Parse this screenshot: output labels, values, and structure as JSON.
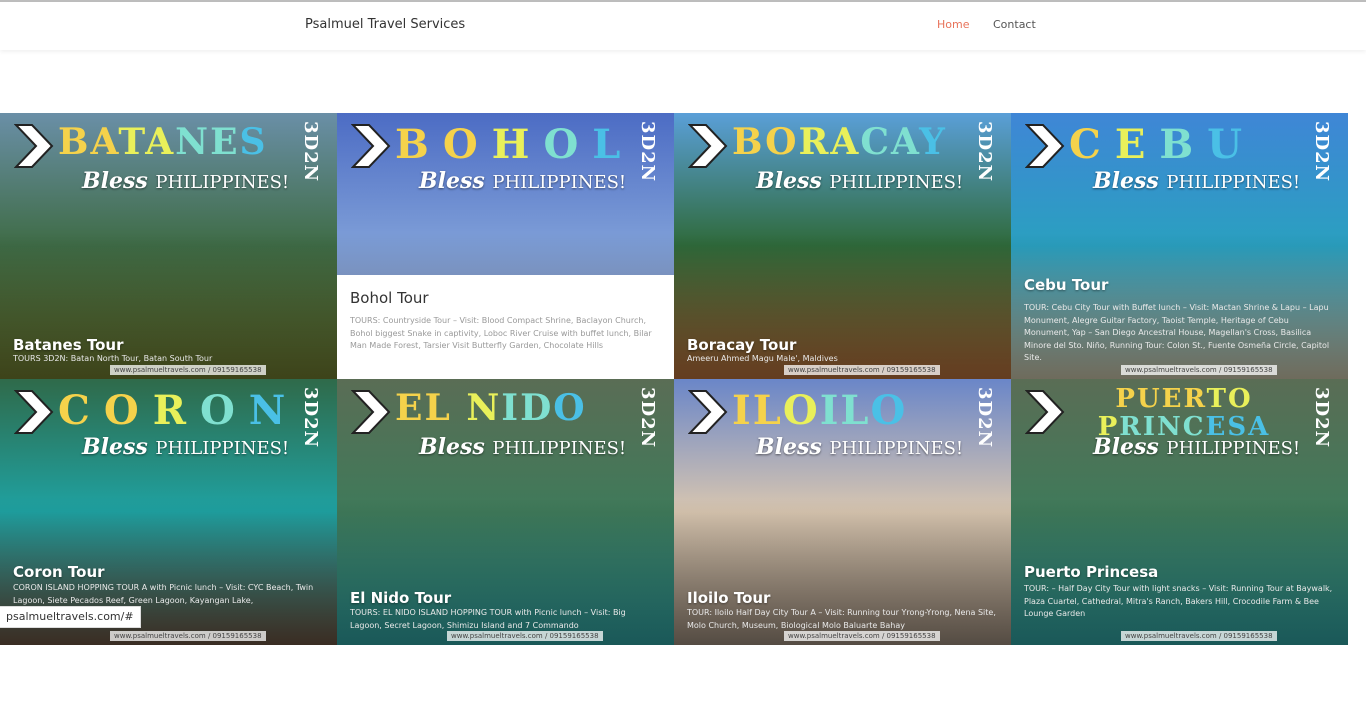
{
  "nav": {
    "brand": "Psalmuel Travel Services",
    "links": [
      "Home",
      "Contact"
    ]
  },
  "status_url": "psalmueltravels.com/#",
  "overlay": {
    "bless": "Bless",
    "philippines": "PHILIPPINES!",
    "days": "3D2N",
    "watermark": "www.psalmueltravels.com / 09159165538"
  },
  "tours": [
    {
      "dest": "BATANES",
      "title": "Batanes Tour",
      "desc": "TOURS 3D2N: Batan North Tour, Batan South Tour",
      "colors": [
        "#f5d24b",
        "#e9f05a",
        "#7fe0d0",
        "#4ac0e6"
      ],
      "bg": [
        "#6a8fa7",
        "#3f6c46",
        "#6f7a2f"
      ]
    },
    {
      "dest": "BOHOL",
      "title": "Bohol Tour",
      "desc": "TOURS: Countryside Tour – Visit: Blood Compact Shrine, Baclayon Church, Bohol biggest Snake in captivity, Loboc River Cruise with buffet lunch, Bilar Man Made Forest, Tarsier Visit Butterfly Garden, Chocolate Hills",
      "colors": [
        "#f5d24b",
        "#e9f05a",
        "#7fe0d0",
        "#4ac0e6"
      ],
      "bg": [
        "#4c6cc4",
        "#7f9fd8",
        "#b8c7e6"
      ]
    },
    {
      "dest": "BORACAY",
      "title": "Boracay Tour",
      "desc": "Ameeru Ahmed Magu Male', Maldives",
      "colors": [
        "#f5d24b",
        "#e9f05a",
        "#7fe0d0",
        "#4ac0e6"
      ],
      "bg": [
        "#5a9fd8",
        "#2f6a3a",
        "#b66e3a"
      ]
    },
    {
      "dest": "CEBU",
      "title": "Cebu Tour",
      "desc": "TOUR: Cebu City Tour with Buffet lunch – Visit: Mactan Shrine & Lapu – Lapu Monument, Alegre Guitar Factory, Taoist Temple, Heritage of Cebu Monument, Yap – San Diego Ancestral House, Magellan's Cross, Basilica Minore del Sto. Niño, Running Tour: Colon St., Fuente Osmeña Circle, Capitol Site.",
      "colors": [
        "#f5d24b",
        "#e9f05a",
        "#7fe0d0",
        "#4ac0e6"
      ],
      "bg": [
        "#3f86d6",
        "#2aa0c0",
        "#c9c3a8"
      ]
    },
    {
      "dest": "CORON",
      "title": "Coron Tour",
      "desc": "CORON ISLAND HOPPING TOUR A with Picnic lunch – Visit: CYC Beach, Twin Lagoon, Siete Pecados Reef, Green Lagoon, Kayangan Lake,",
      "colors": [
        "#f5d24b",
        "#e9f05a",
        "#7fe0d0",
        "#4ac0e6"
      ],
      "bg": [
        "#2f6a4a",
        "#1fa2a2",
        "#6a5240"
      ]
    },
    {
      "dest": "EL NIDO",
      "title": "El Nido Tour",
      "desc": "TOURS: EL NIDO ISLAND HOPPING TOUR with Picnic lunch – Visit: Big Lagoon, Secret Lagoon, Shimizu Island and 7 Commando",
      "colors": [
        "#f5d24b",
        "#e9f05a",
        "#7fe0d0",
        "#4ac0e6"
      ],
      "bg": [
        "#5a6d55",
        "#3f7a5a",
        "#2fa0a0"
      ]
    },
    {
      "dest": "ILOILO",
      "title": "Iloilo Tour",
      "desc": "TOUR: Iloilo Half Day City Tour A – Visit: Running tour Yrong-Yrong, Nena Site, Molo Church, Museum, Biological Molo Baluarte Bahay",
      "colors": [
        "#f5d24b",
        "#e9f05a",
        "#7fe0d0",
        "#4ac0e6"
      ],
      "bg": [
        "#6a86c8",
        "#d8c6b0",
        "#9a8a7a"
      ]
    },
    {
      "dest": "PUERTO PRINCESA",
      "title": "Puerto Princesa",
      "desc": "TOUR: – Half Day City Tour with light snacks – Visit: Running Tour at Baywalk, Plaza Cuartel, Cathedral, Mitra's Ranch, Bakers Hill, Crocodile Farm & Bee Lounge Garden",
      "colors": [
        "#f5d24b",
        "#e9f05a",
        "#7fe0d0",
        "#4ac0e6"
      ],
      "bg": [
        "#5a6d55",
        "#3f7a5a",
        "#2fa0a0"
      ]
    }
  ]
}
